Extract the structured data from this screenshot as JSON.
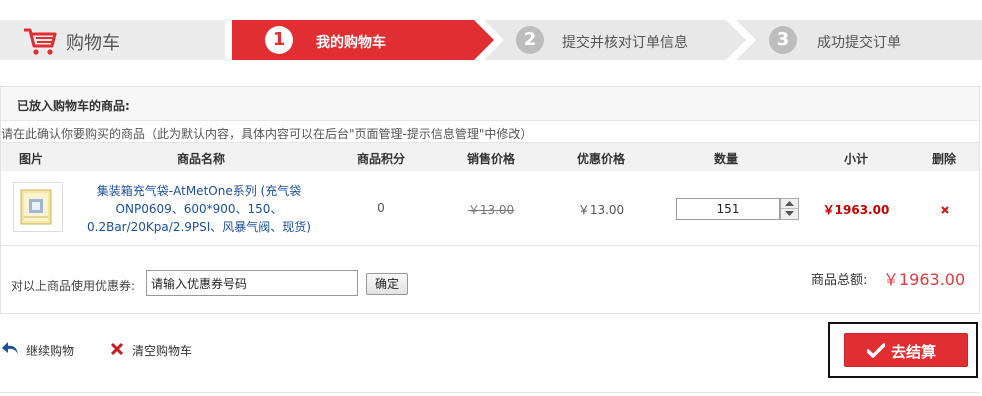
{
  "steps": {
    "cart_title": "购物车",
    "items": [
      {
        "num": "1",
        "label": "我的购物车"
      },
      {
        "num": "2",
        "label": "提交并核对订单信息"
      },
      {
        "num": "3",
        "label": "成功提交订单"
      }
    ],
    "active_color": "#e02e32",
    "inactive_color": "#e8e8e8"
  },
  "cart": {
    "title": "已放入购物车的商品:",
    "notice": "请在此确认你要购买的商品（此为默认内容，具体内容可以在后台\"页面管理-提示信息管理\"中修改）",
    "columns": [
      "图片",
      "商品名称",
      "商品积分",
      "销售价格",
      "优惠价格",
      "数量",
      "小计",
      "删除"
    ],
    "items": [
      {
        "name": "集装箱充气袋-AtMetOne系列 (充气袋 ONP0609、600*900、150、0.2Bar/20Kpa/2.9PSI、风暴气阀、现货)",
        "points": "0",
        "price": "￥13.00",
        "discount_price": "￥13.00",
        "quantity": "151",
        "subtotal": "￥1963.00"
      }
    ],
    "coupon": {
      "label": "对以上商品使用优惠券:",
      "placeholder": "请输入优惠券号码",
      "button": "确定"
    },
    "total": {
      "label": "商品总额:",
      "value": "￥1963.00"
    }
  },
  "actions": {
    "continue": "继续购物",
    "clear": "清空购物车",
    "checkout": "去结算"
  }
}
